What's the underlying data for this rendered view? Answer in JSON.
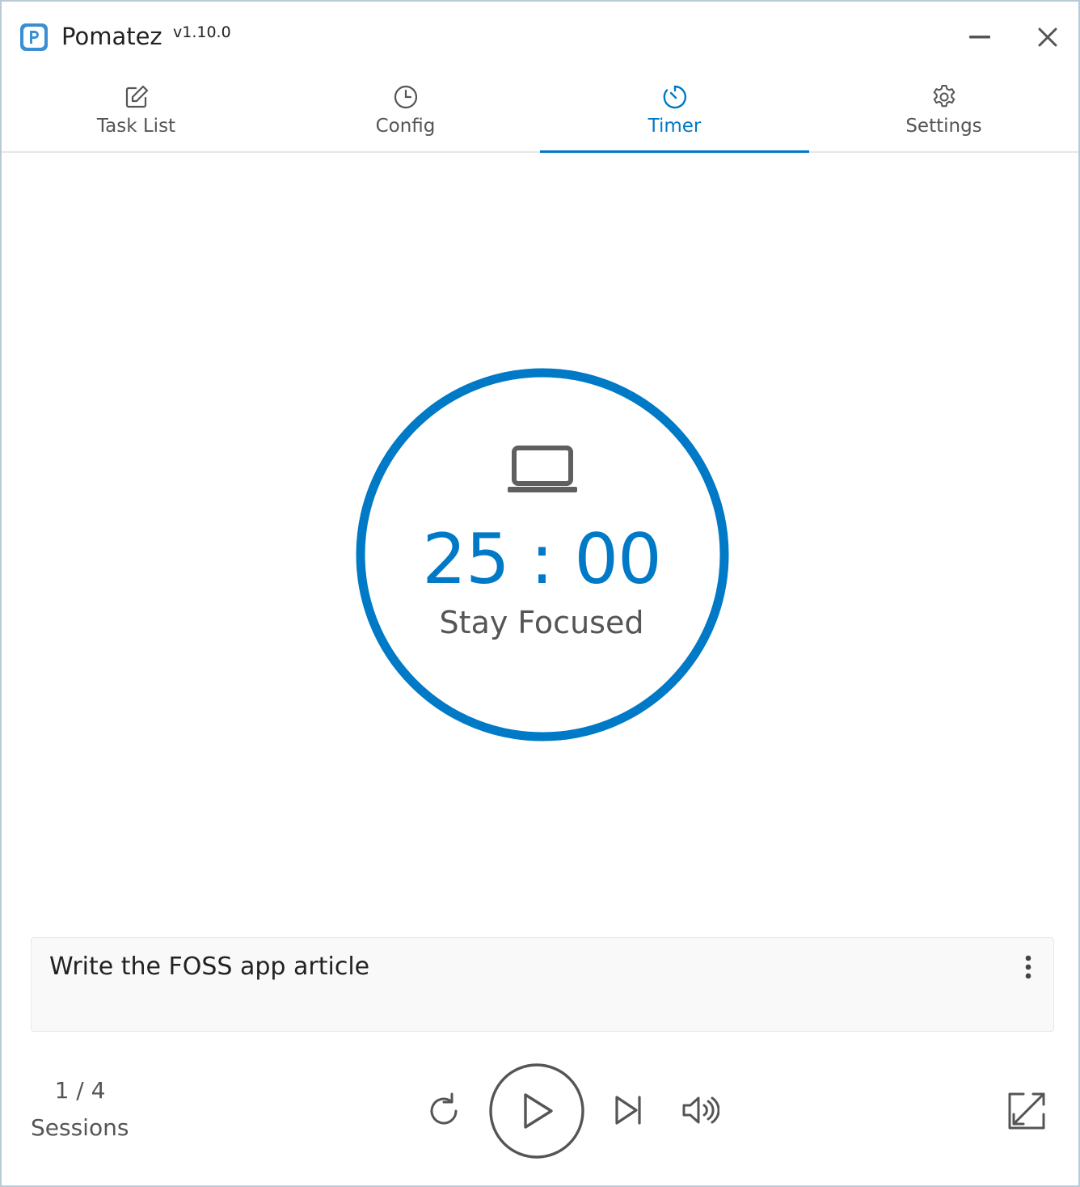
{
  "window": {
    "app_name": "Pomatez",
    "version": "v1.10.0",
    "logo_letter": "P",
    "minimize_icon": "minimize-icon",
    "close_icon": "close-icon"
  },
  "tabs": [
    {
      "label": "Task List",
      "icon": "edit-icon",
      "active": false
    },
    {
      "label": "Config",
      "icon": "clock-icon",
      "active": false
    },
    {
      "label": "Timer",
      "icon": "timer-icon",
      "active": true
    },
    {
      "label": "Settings",
      "icon": "gear-icon",
      "active": false
    }
  ],
  "timer": {
    "time": "25 : 00",
    "status": "Stay Focused",
    "icon": "laptop-icon",
    "progress": 1.0
  },
  "task": {
    "title": "Write the FOSS app article",
    "menu_icon": "more-vertical-icon"
  },
  "sessions": {
    "count": "1 / 4",
    "label": "Sessions"
  },
  "controls": {
    "reset_icon": "reset-icon",
    "play_icon": "play-icon",
    "skip_icon": "skip-icon",
    "volume_icon": "volume-icon",
    "expand_icon": "expand-icon"
  },
  "colors": {
    "accent": "#0079c6",
    "text": "#555555",
    "border": "#b9cbd6"
  }
}
